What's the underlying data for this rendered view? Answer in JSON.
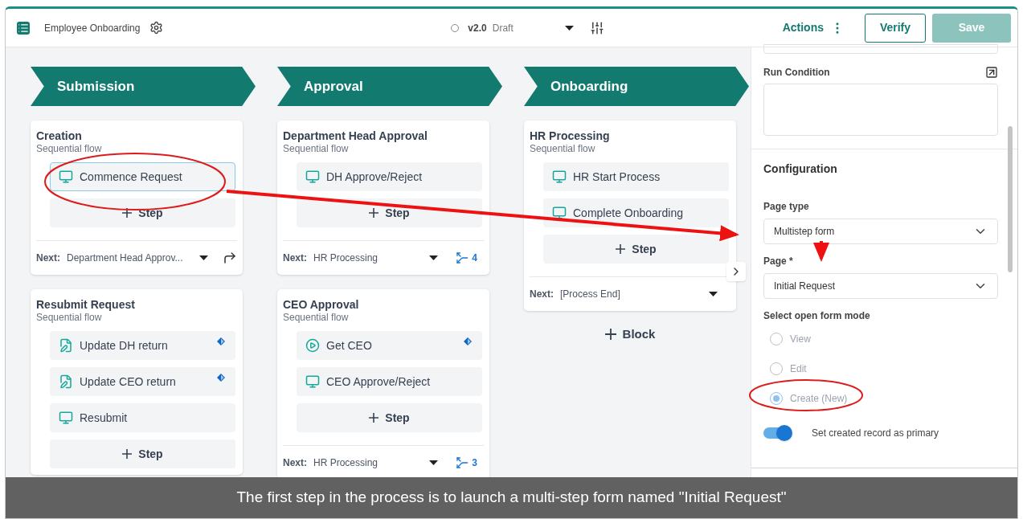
{
  "header": {
    "title": "Employee Onboarding",
    "version": "v2.0",
    "status": "Draft",
    "actions_label": "Actions",
    "buttons": [
      {
        "label": "Verify",
        "kind": "outline"
      },
      {
        "label": "Save",
        "kind": "primary",
        "disabled": true
      }
    ]
  },
  "stages": [
    {
      "title": "Submission",
      "blocks": [
        {
          "title": "Creation",
          "subtitle": "Sequential flow",
          "steps": [
            {
              "label": "Commence Request",
              "kind": "page",
              "selected": true,
              "flagged": false
            }
          ],
          "add_step": "Step",
          "next": {
            "label": "Next:",
            "value": "Department Head Approv...",
            "kind": "link"
          }
        },
        {
          "title": "Resubmit Request",
          "subtitle": "Sequential flow",
          "steps": [
            {
              "label": "Update DH return",
              "kind": "update",
              "selected": false,
              "flagged": true
            },
            {
              "label": "Update CEO return",
              "kind": "update",
              "selected": false,
              "flagged": true
            },
            {
              "label": "Resubmit",
              "kind": "page",
              "selected": false,
              "flagged": false
            }
          ],
          "add_step": "Step"
        }
      ]
    },
    {
      "title": "Approval",
      "blocks": [
        {
          "title": "Department Head Approval",
          "subtitle": "Sequential flow",
          "steps": [
            {
              "label": "DH Approve/Reject",
              "kind": "page",
              "selected": false,
              "flagged": false
            }
          ],
          "add_step": "Step",
          "next": {
            "label": "Next:",
            "value": "HR Processing",
            "kind": "branch",
            "branch_count": "4"
          }
        },
        {
          "title": "CEO Approval",
          "subtitle": "Sequential flow",
          "steps": [
            {
              "label": "Get CEO",
              "kind": "script",
              "selected": false,
              "flagged": true
            },
            {
              "label": "CEO Approve/Reject",
              "kind": "page",
              "selected": false,
              "flagged": false
            }
          ],
          "add_step": "Step",
          "next": {
            "label": "Next:",
            "value": "HR Processing",
            "kind": "branch",
            "branch_count": "3"
          }
        }
      ]
    },
    {
      "title": "Onboarding",
      "blocks": [
        {
          "title": "HR Processing",
          "subtitle": "Sequential flow",
          "steps": [
            {
              "label": "HR Start Process",
              "kind": "page",
              "selected": false,
              "flagged": false
            },
            {
              "label": "Complete Onboarding",
              "kind": "page",
              "selected": false,
              "flagged": false
            }
          ],
          "add_step": "Step",
          "next": {
            "label": "Next:",
            "value": "[Process End]",
            "kind": "plain"
          },
          "expander": true
        }
      ],
      "add_block": "Block"
    }
  ],
  "panel": {
    "run_condition_label": "Run Condition",
    "config_heading": "Configuration",
    "page_type_label": "Page type",
    "page_type_value": "Multistep form",
    "page_label": "Page *",
    "page_value": "Initial Request",
    "mode_label": "Select open form mode",
    "modes": [
      {
        "label": "View",
        "selected": false
      },
      {
        "label": "Edit",
        "selected": false
      },
      {
        "label": "Create (New)",
        "selected": true
      }
    ],
    "toggle": {
      "label": "Set created record as primary",
      "on": true
    }
  },
  "caption": "The first step in the process is to launch a multi-step form named \"Initial Request\""
}
